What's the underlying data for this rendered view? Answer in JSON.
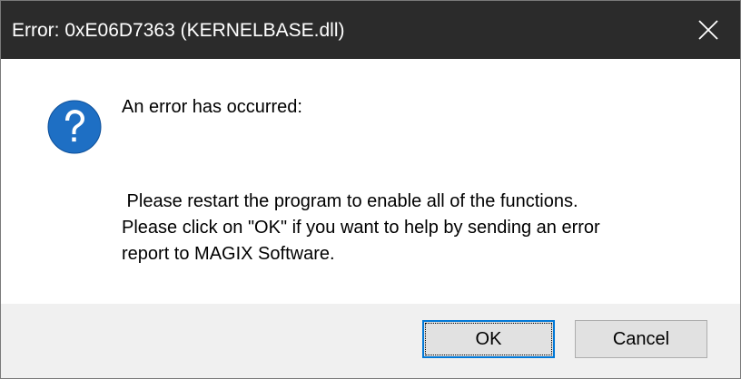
{
  "window": {
    "title": "Error: 0xE06D7363 (KERNELBASE.dll)",
    "close_icon": "close-icon"
  },
  "content": {
    "icon": "question-icon",
    "heading": "An error has occurred:",
    "message_lines": [
      " Please restart the program to enable all of the functions.",
      "Please click on \"OK\" if you want to help by sending an error",
      "report to MAGIX Software."
    ]
  },
  "buttons": {
    "ok_label": "OK",
    "cancel_label": "Cancel"
  },
  "colors": {
    "titlebar": "#2b2b2b",
    "accent": "#0078d7",
    "icon_blue": "#1e6fc4",
    "footer": "#f0f0f0"
  }
}
